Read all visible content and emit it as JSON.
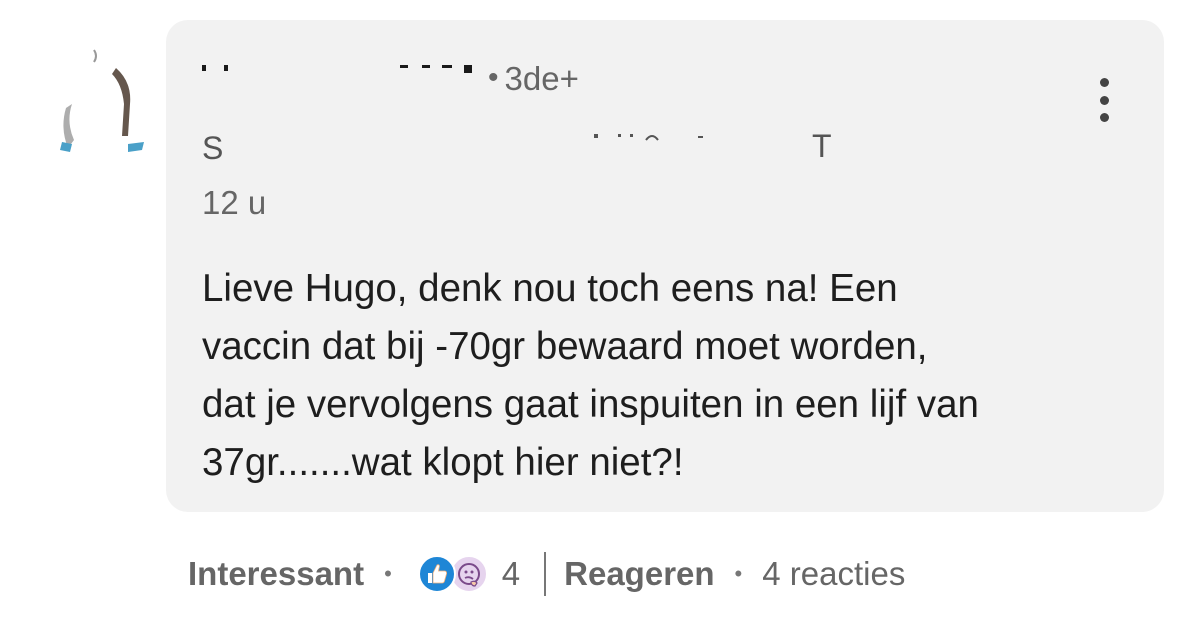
{
  "comment": {
    "author": {
      "name": "",
      "degree_separator": "•",
      "degree": "3de+",
      "headline_fragments": [
        "S",
        "T"
      ]
    },
    "time": "12 u",
    "text": "Lieve Hugo, denk nou toch eens na! Een\nvaccin dat bij -70gr bewaard moet worden,\ndat je vervolgens gaat inspuiten in een lijf van\n37gr.......wat klopt hier niet?!",
    "menu_icon": "more-vertical-icon"
  },
  "actions": {
    "reaction_label": "Interessant",
    "separator": "•",
    "reaction_icons": [
      "like-icon",
      "curious-icon"
    ],
    "reaction_count": "4",
    "reply_label": "Reageren",
    "replies_count_text": "4 reacties"
  },
  "colors": {
    "bubble_bg": "#f2f2f2",
    "like_blue": "#1e86d6",
    "curious_bg": "#e6d4ee",
    "text_secondary": "#666666",
    "text_primary": "#1e1e1e"
  }
}
